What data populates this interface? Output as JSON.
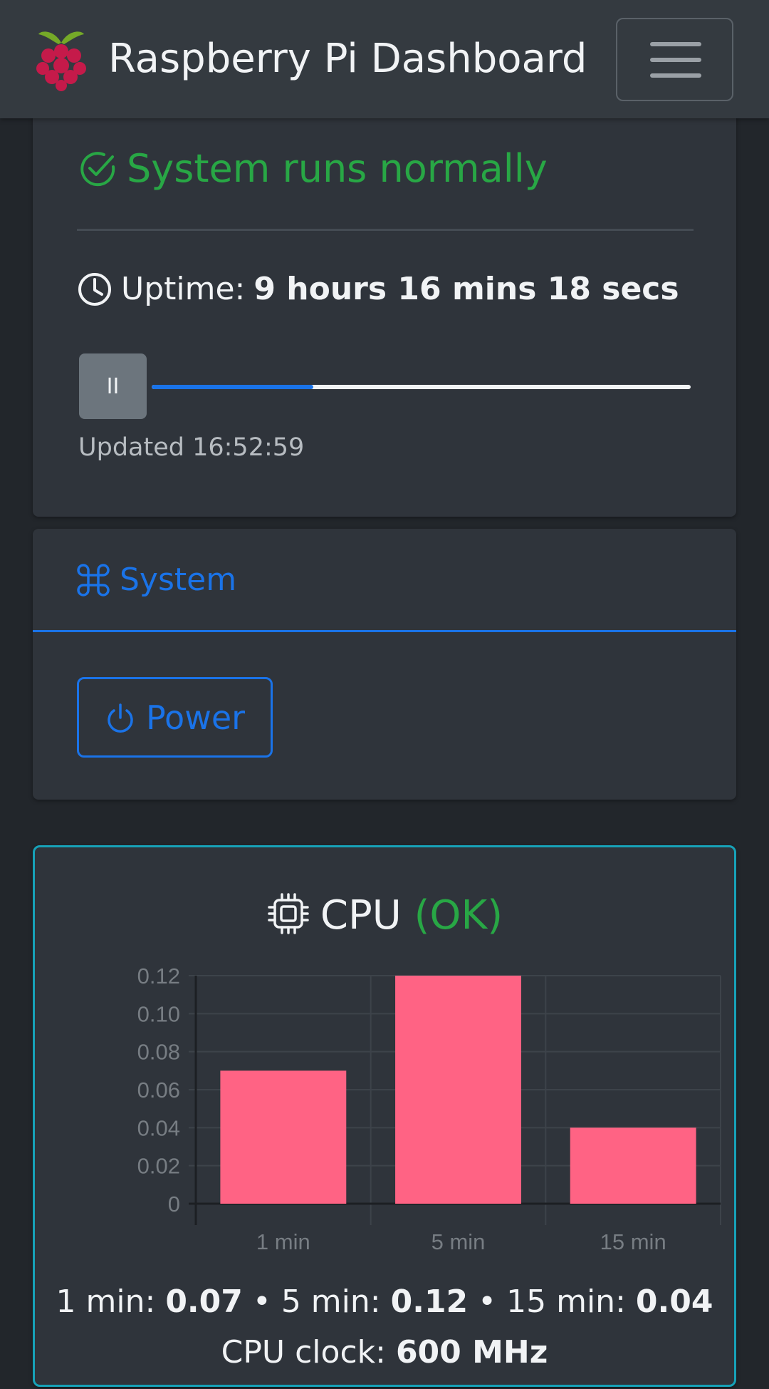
{
  "navbar": {
    "brand": "Raspberry Pi Dashboard",
    "logo_icon": "raspberry-pi-logo",
    "menu_icon": "hamburger-menu-icon"
  },
  "status": {
    "message": "System runs normally",
    "uptime_label": "Uptime:",
    "uptime_value": "9 hours 16 mins 18 secs",
    "pause_label": "II",
    "refresh_progress": 0.3,
    "updated": "Updated 16:52:59"
  },
  "system": {
    "title": "System",
    "power_label": "Power"
  },
  "cpu": {
    "title": "CPU",
    "status": "(OK)",
    "load_1_label": "1 min:",
    "load_1": "0.07",
    "load_5_label": "5 min:",
    "load_5": "0.12",
    "load_15_label": "15 min:",
    "load_15": "0.04",
    "sep": "•",
    "clock_label": "CPU clock:",
    "clock_value": "600 MHz"
  },
  "colors": {
    "accent": "#1a73e8",
    "ok": "#28a745",
    "bar": "#ff6384",
    "card_border": "#17a2b8"
  },
  "chart_data": {
    "type": "bar",
    "categories": [
      "1 min",
      "5 min",
      "15 min"
    ],
    "values": [
      0.07,
      0.12,
      0.04
    ],
    "yticks": [
      "0",
      "0.02",
      "0.04",
      "0.06",
      "0.08",
      "0.10",
      "0.12"
    ],
    "ylim": [
      0,
      0.12
    ],
    "grid": true
  }
}
